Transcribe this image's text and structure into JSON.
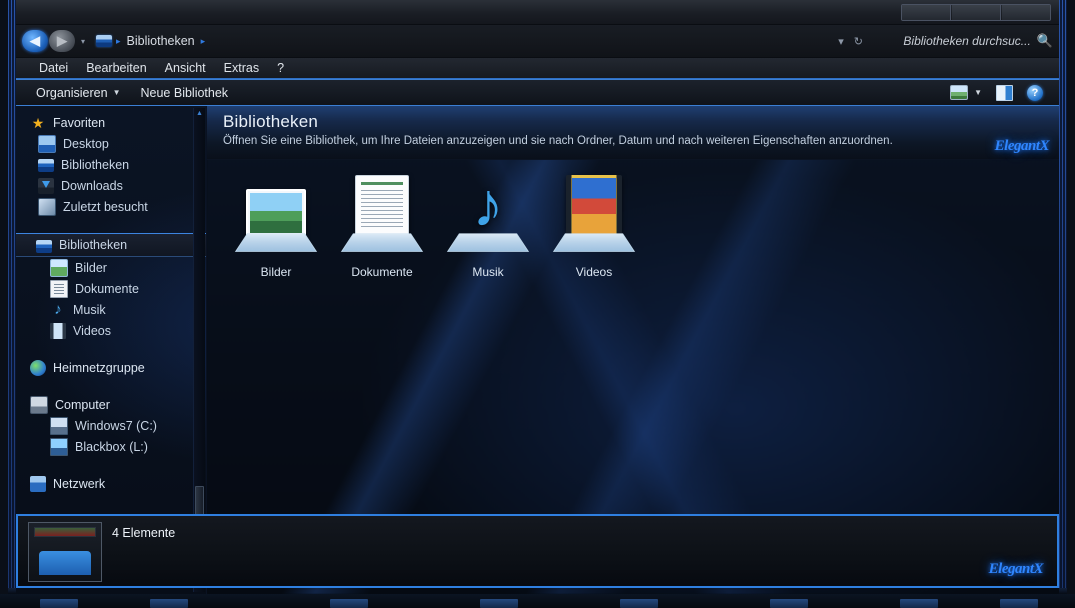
{
  "window": {
    "controls": [
      "minimize",
      "maximize",
      "close"
    ]
  },
  "address": {
    "back_icon": "◀",
    "forward_icon": "▶",
    "history_caret": "▾",
    "crumb_icon": "libraries-icon",
    "crumb_sep": "▸",
    "crumb_label": "Bibliotheken",
    "right_caret": "▾",
    "refresh_icon": "↻"
  },
  "search": {
    "value": "Bibliotheken durchsuc...",
    "placeholder": "Bibliotheken durchsuchen",
    "icon": "search-icon"
  },
  "menu": {
    "items": [
      {
        "label": "Datei"
      },
      {
        "label": "Bearbeiten"
      },
      {
        "label": "Ansicht"
      },
      {
        "label": "Extras"
      },
      {
        "label": "?"
      }
    ]
  },
  "toolbar": {
    "organize_label": "Organisieren",
    "organize_caret": "▼",
    "new_library_label": "Neue Bibliothek",
    "view_icon": "view-mode-icon",
    "view_caret": "▼",
    "preview_pane_icon": "preview-pane-icon",
    "help_icon": "?"
  },
  "sidebar": {
    "groups": [
      {
        "head": {
          "label": "Favoriten",
          "icon": "star-icon",
          "icon_class": "star",
          "glyph": "★"
        },
        "items": [
          {
            "label": "Desktop",
            "icon": "desktop-icon",
            "icon_class": "desk"
          },
          {
            "label": "Bibliotheken",
            "icon": "libraries-icon",
            "icon_class": "lib"
          },
          {
            "label": "Downloads",
            "icon": "downloads-icon",
            "icon_class": "dl"
          },
          {
            "label": "Zuletzt besucht",
            "icon": "recent-places-icon",
            "icon_class": "recent"
          }
        ]
      },
      {
        "head": {
          "label": "Bibliotheken",
          "icon": "libraries-icon",
          "icon_class": "lib",
          "selected": true
        },
        "items": [
          {
            "label": "Bilder",
            "icon": "pictures-icon",
            "icon_class": "pic"
          },
          {
            "label": "Dokumente",
            "icon": "documents-icon",
            "icon_class": "doc"
          },
          {
            "label": "Musik",
            "icon": "music-icon",
            "icon_class": "music",
            "glyph": "♪"
          },
          {
            "label": "Videos",
            "icon": "videos-icon",
            "icon_class": "video"
          }
        ]
      },
      {
        "head": {
          "label": "Heimnetzgruppe",
          "icon": "homegroup-icon",
          "icon_class": "homegroup"
        },
        "items": []
      },
      {
        "head": {
          "label": "Computer",
          "icon": "computer-icon",
          "icon_class": "computer"
        },
        "items": [
          {
            "label": "Windows7 (C:)",
            "icon": "hard-drive-icon",
            "icon_class": "drive"
          },
          {
            "label": "Blackbox (L:)",
            "icon": "hard-drive-icon",
            "icon_class": "drive bb"
          }
        ]
      },
      {
        "head": {
          "label": "Netzwerk",
          "icon": "network-icon",
          "icon_class": "network",
          "clipped": true
        },
        "items": []
      }
    ],
    "scrollbar": {
      "up_arrow": "▲",
      "down_arrow": "▼"
    }
  },
  "header": {
    "title": "Bibliotheken",
    "subtitle": "Öffnen Sie eine Bibliothek, um Ihre Dateien anzuzeigen und sie nach Ordner, Datum und nach weiteren Eigenschaften anzuordnen."
  },
  "libraries": [
    {
      "label": "Bilder",
      "icon": "pictures-library-icon"
    },
    {
      "label": "Dokumente",
      "icon": "documents-library-icon"
    },
    {
      "label": "Musik",
      "icon": "music-library-icon",
      "glyph": "♪"
    },
    {
      "label": "Videos",
      "icon": "videos-library-icon"
    }
  ],
  "status": {
    "text": "4 Elemente",
    "icon": "libraries-status-icon"
  },
  "branding": {
    "watermark": "ElegantX"
  },
  "colors": {
    "accent_blue": "#2f7fe0",
    "frame_blue": "#2a58a8",
    "text_primary": "#e9f0f8",
    "text_secondary": "#c2cfdf",
    "background_dark": "#070d17"
  }
}
